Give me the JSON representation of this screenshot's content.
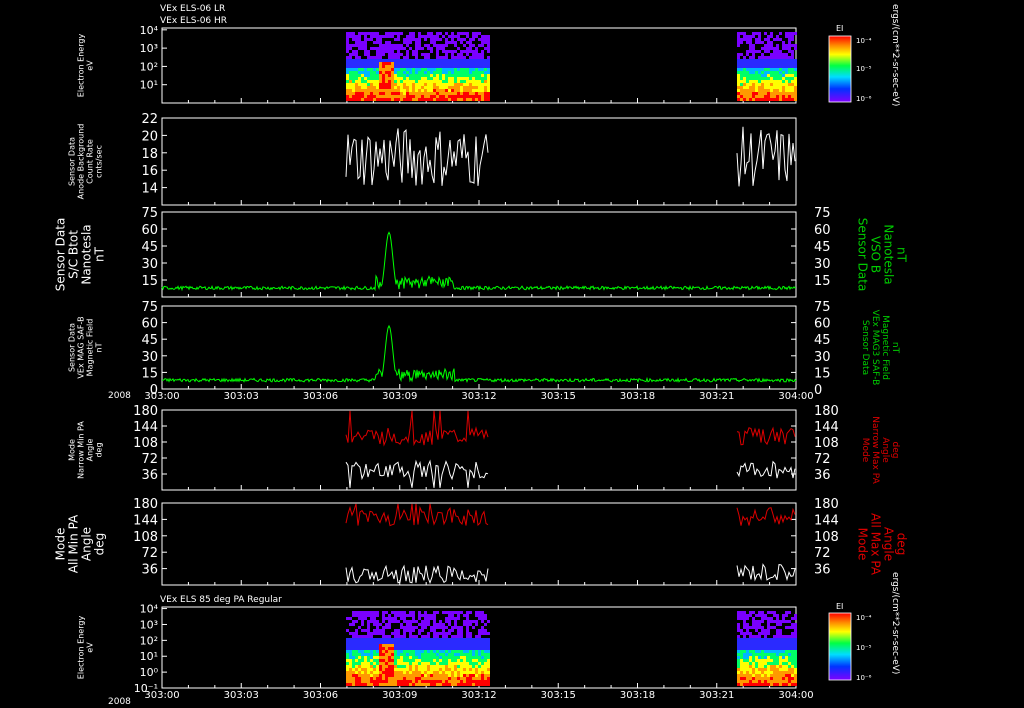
{
  "header": {
    "line1": "VEx ELS-06 LR",
    "line2": "VEx ELS-06 HR"
  },
  "subheader": "VEx ELS 85 deg PA Regular",
  "year_label": "2008",
  "colors": {
    "background": "#000000",
    "frame": "#ffffff",
    "green_trace": "#00ff00",
    "green_label": "#00cc00",
    "red_trace": "#dd0000",
    "red_label": "#dd0000",
    "white_trace": "#ffffff"
  },
  "colorbar": {
    "title": "EI",
    "ticks": [
      "10⁻⁴",
      "10⁻⁵",
      "10⁻⁶"
    ],
    "units": "ergs/(cm**2-sr-sec-eV)"
  },
  "chart_data": [
    {
      "type": "heatmap",
      "ylabel": [
        "Electron Energy",
        "eV"
      ],
      "ytick_labels": [
        "10⁴",
        "10³",
        "10²",
        "10¹"
      ],
      "ylim_log10": [
        0,
        4.1
      ],
      "x_ticks": [
        "303:00",
        "303:03",
        "303:06",
        "303:09",
        "303:12",
        "303:15",
        "303:18",
        "303:21",
        "304:00"
      ],
      "data_coverage": [
        [
          "303:07.0",
          "303:12.1"
        ],
        [
          "303:21.6",
          "304:00"
        ]
      ],
      "legend": "colorbar EI"
    },
    {
      "type": "line",
      "ylabel": [
        "Sensor Data",
        "Anode Background",
        "Count Rate",
        "cnts/sec"
      ],
      "ylim": [
        12,
        22
      ],
      "yticks": [
        14,
        16,
        18,
        20,
        22
      ],
      "series": [
        {
          "color": "white",
          "segments": [
            [
              "303:07.0",
              "303:12.1"
            ],
            [
              "303:21.6",
              "304:00"
            ]
          ],
          "range": [
            14,
            21
          ]
        }
      ]
    },
    {
      "type": "line",
      "ylabel": [
        "Sensor Data",
        "S/C Btot",
        "Nanotesla",
        "nT"
      ],
      "ylabel_right": [
        "Sensor Data",
        "VSO B",
        "Nanotesla",
        "nT"
      ],
      "ylim": [
        0,
        75
      ],
      "yticks": [
        15,
        30,
        45,
        60,
        75
      ],
      "series": [
        {
          "color": "green",
          "baseline": 8,
          "peak": {
            "x": "303:08.5",
            "y": 57
          }
        }
      ]
    },
    {
      "type": "line",
      "ylabel": [
        "Sensor Data",
        "VEx MAG SAF-B",
        "Magnetic Field",
        "nT"
      ],
      "ylabel_right": [
        "Sensor Data",
        "VEx MAG3 SAF-B",
        "Magnetic Field",
        "nT"
      ],
      "ylim": [
        0,
        75
      ],
      "yticks": [
        0,
        15,
        30,
        45,
        60,
        75
      ],
      "series": [
        {
          "color": "green",
          "baseline": 8,
          "peak": {
            "x": "303:08.5",
            "y": 57
          }
        }
      ]
    },
    {
      "type": "line",
      "ylabel": [
        "Mode",
        "Narrow Min PA",
        "Angle",
        "deg"
      ],
      "ylabel_right": [
        "Mode",
        "Narrow Max PA",
        "Angle",
        "deg"
      ],
      "ylim": [
        0,
        180
      ],
      "yticks": [
        36,
        72,
        108,
        144,
        180
      ],
      "series": [
        {
          "name_hidden": "max",
          "color": "red",
          "typical": 120
        },
        {
          "name_hidden": "min",
          "color": "white",
          "typical": 50
        }
      ]
    },
    {
      "type": "line",
      "ylabel": [
        "Mode",
        "All Min PA",
        "Angle",
        "deg"
      ],
      "ylabel_right": [
        "Mode",
        "All Max PA",
        "Angle",
        "deg"
      ],
      "ylim": [
        0,
        180
      ],
      "yticks": [
        36,
        72,
        108,
        144,
        180
      ],
      "series": [
        {
          "color": "red",
          "typical": 150
        },
        {
          "color": "white",
          "typical": 30
        }
      ]
    },
    {
      "type": "heatmap",
      "ylabel": [
        "Electron Energy",
        "eV"
      ],
      "ytick_labels": [
        "10⁴",
        "10³",
        "10²",
        "10¹",
        "10⁰",
        "10⁻¹"
      ],
      "ylim_log10": [
        -1,
        4.1
      ],
      "x_ticks": [
        "303:00",
        "303:03",
        "303:06",
        "303:09",
        "303:12",
        "303:15",
        "303:18",
        "303:21",
        "304:00"
      ]
    }
  ]
}
